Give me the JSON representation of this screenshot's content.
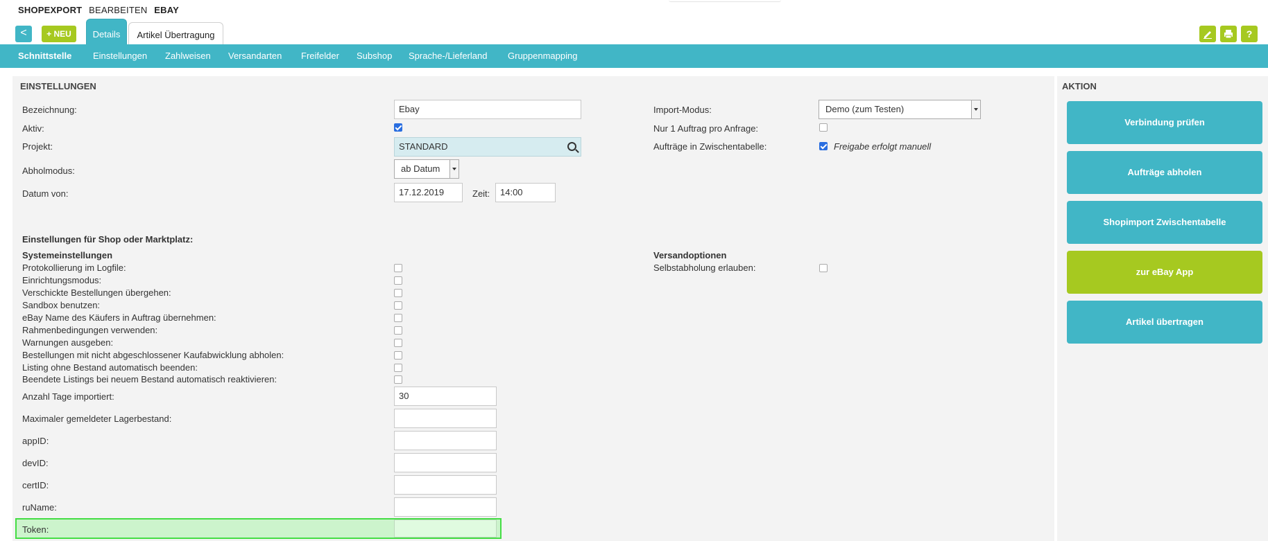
{
  "breadcrumb": {
    "part1": "SHOPEXPORT",
    "part2": "BEARBEITEN",
    "part3": "EBAY"
  },
  "toolbar": {
    "back_label": "<",
    "new_label": "+ NEU"
  },
  "tabs": [
    {
      "label": "Details"
    },
    {
      "label": "Artikel Übertragung"
    }
  ],
  "top_icons": [
    "edit-icon",
    "print-icon",
    "help-icon"
  ],
  "top_icons_glyph": {
    "help": "?"
  },
  "nav": [
    {
      "label": "Schnittstelle"
    },
    {
      "label": "Einstellungen"
    },
    {
      "label": "Zahlweisen"
    },
    {
      "label": "Versandarten"
    },
    {
      "label": "Freifelder"
    },
    {
      "label": "Subshop"
    },
    {
      "label": "Sprache-/Lieferland"
    },
    {
      "label": "Gruppenmapping"
    }
  ],
  "settings": {
    "title": "EINSTELLUNGEN",
    "bezeichnung_label": "Bezeichnung:",
    "bezeichnung_value": "Ebay",
    "aktiv_label": "Aktiv:",
    "aktiv_checked": true,
    "projekt_label": "Projekt:",
    "projekt_value": "STANDARD",
    "abholmodus_label": "Abholmodus:",
    "abholmodus_value": "ab Datum",
    "datum_label": "Datum von:",
    "datum_value": "17.12.2019",
    "zeit_label": "Zeit:",
    "zeit_value": "14:00",
    "import_modus_label": "Import-Modus:",
    "import_modus_value": "Demo (zum Testen)",
    "nur1_label": "Nur 1 Auftrag pro Anfrage:",
    "nur1_checked": false,
    "zwischen_label": "Aufträge in Zwischentabelle:",
    "zwischen_checked": true,
    "zwischen_note": "Freigabe erfolgt manuell"
  },
  "shop": {
    "heading": "Einstellungen für Shop oder Marktplatz:",
    "system_heading": "Systemeinstellungen",
    "versand_heading": "Versandoptionen",
    "selbst_label": "Selbstabholung erlauben:",
    "checkboxes": [
      {
        "label": "Protokollierung im Logfile:",
        "checked": false
      },
      {
        "label": "Einrichtungsmodus:",
        "checked": false
      },
      {
        "label": "Verschickte Bestellungen übergehen:",
        "checked": false
      },
      {
        "label": "Sandbox benutzen:",
        "checked": false
      },
      {
        "label": "eBay Name des Käufers in Auftrag übernehmen:",
        "checked": false
      },
      {
        "label": "Rahmenbedingungen verwenden:",
        "checked": false
      },
      {
        "label": "Warnungen ausgeben:",
        "checked": false
      },
      {
        "label": "Bestellungen mit nicht abgeschlossener Kaufabwicklung abholen:",
        "checked": false
      },
      {
        "label": "Listing ohne Bestand automatisch beenden:",
        "checked": false
      },
      {
        "label": "Beendete Listings bei neuem Bestand automatisch reaktivieren:",
        "checked": false
      }
    ],
    "fields": [
      {
        "label": "Anzahl Tage importiert:",
        "value": "30"
      },
      {
        "label": "Maximaler gemeldeter Lagerbestand:",
        "value": ""
      },
      {
        "label": "appID:",
        "value": ""
      },
      {
        "label": "devID:",
        "value": ""
      },
      {
        "label": "certID:",
        "value": ""
      },
      {
        "label": "ruName:",
        "value": ""
      },
      {
        "label": "Token:",
        "value": ""
      }
    ]
  },
  "aktion": {
    "title": "AKTION",
    "buttons": [
      {
        "label": "Verbindung prüfen",
        "color": "#41b6c6"
      },
      {
        "label": "Aufträge abholen",
        "color": "#41b6c6"
      },
      {
        "label": "Shopimport Zwischentabelle",
        "color": "#41b6c6"
      },
      {
        "label": "zur eBay App",
        "color": "#a6c920"
      },
      {
        "label": "Artikel übertragen",
        "color": "#41b6c6"
      }
    ]
  },
  "colors": {
    "accent": "#41b6c6",
    "green": "#a6c920",
    "highlight": "#44dd44"
  }
}
